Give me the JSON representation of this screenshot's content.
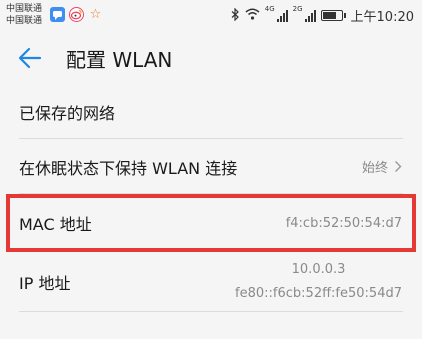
{
  "status_bar": {
    "carrier_1": "中国联通",
    "carrier_2": "中国联通",
    "left_icons": [
      "chat-icon",
      "weibo-icon",
      "star-icon"
    ],
    "network_tag_1": "4G",
    "network_tag_2": "2G",
    "battery_level": 0.8,
    "time": "上午10:20"
  },
  "titlebar": {
    "title": "配置 WLAN"
  },
  "settings": {
    "saved_networks": "已保存的网络",
    "keep_wlan": {
      "label": "在休眠状态下保持 WLAN 连接",
      "value": "始终"
    },
    "mac": {
      "label": "MAC 地址",
      "value": "f4:cb:52:50:54:d7"
    },
    "ip": {
      "label": "IP 地址",
      "ipv4": "10.0.0.3",
      "ipv6": "fe80::f6cb:52ff:fe50:54d7"
    }
  },
  "colors": {
    "highlight_box": "#e53935",
    "back_arrow": "#1e88e5",
    "background": "#f5f5f5"
  }
}
